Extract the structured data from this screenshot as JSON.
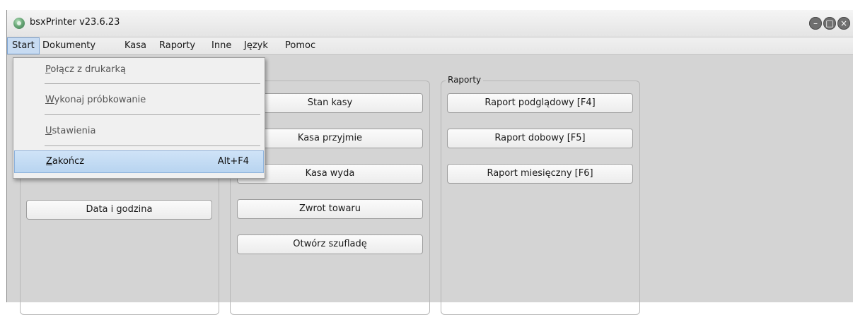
{
  "window": {
    "title": "bsxPrinter v23.6.23",
    "controls": [
      "–",
      "□",
      "×"
    ]
  },
  "menubar": {
    "items": [
      "Start",
      "Dokumenty",
      "Kasa",
      "Raporty",
      "Inne",
      "Język",
      "Pomoc"
    ]
  },
  "dropdown": {
    "items": [
      {
        "first": "P",
        "rest": "ołącz z drukarką",
        "shortcut": ""
      },
      {
        "first": "W",
        "rest": "ykonaj próbkowanie",
        "shortcut": ""
      },
      {
        "first": "U",
        "rest": "stawienia",
        "shortcut": ""
      },
      {
        "first": "Z",
        "rest": "akończ",
        "shortcut": "Alt+F4"
      }
    ]
  },
  "left_group": {
    "buttons": [
      "Data i godzina"
    ]
  },
  "kasa_group": {
    "buttons": [
      "Stan kasy",
      "Kasa przyjmie",
      "Kasa wyda",
      "Zwrot towaru",
      "Otwórz szufladę"
    ]
  },
  "raporty_group": {
    "label": "Raporty",
    "buttons": [
      "Raport podglądowy [F4]",
      "Raport dobowy [F5]",
      "Raport miesięczny [F6]"
    ]
  }
}
